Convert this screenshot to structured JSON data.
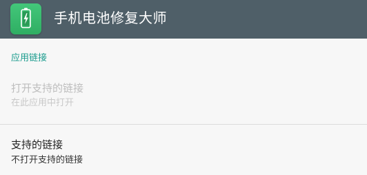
{
  "appbar": {
    "icon": "battery-app-icon",
    "title": "手机电池修复大师",
    "background_color": "#4f5f68",
    "icon_color": "#3bbb6f"
  },
  "section": {
    "header": "应用链接",
    "accent_color": "#1a9b8d"
  },
  "preferences": [
    {
      "title": "打开支持的链接",
      "summary": "在此应用中打开",
      "enabled": false
    },
    {
      "title": "支持的链接",
      "summary": "不打开支持的链接",
      "enabled": true
    }
  ]
}
